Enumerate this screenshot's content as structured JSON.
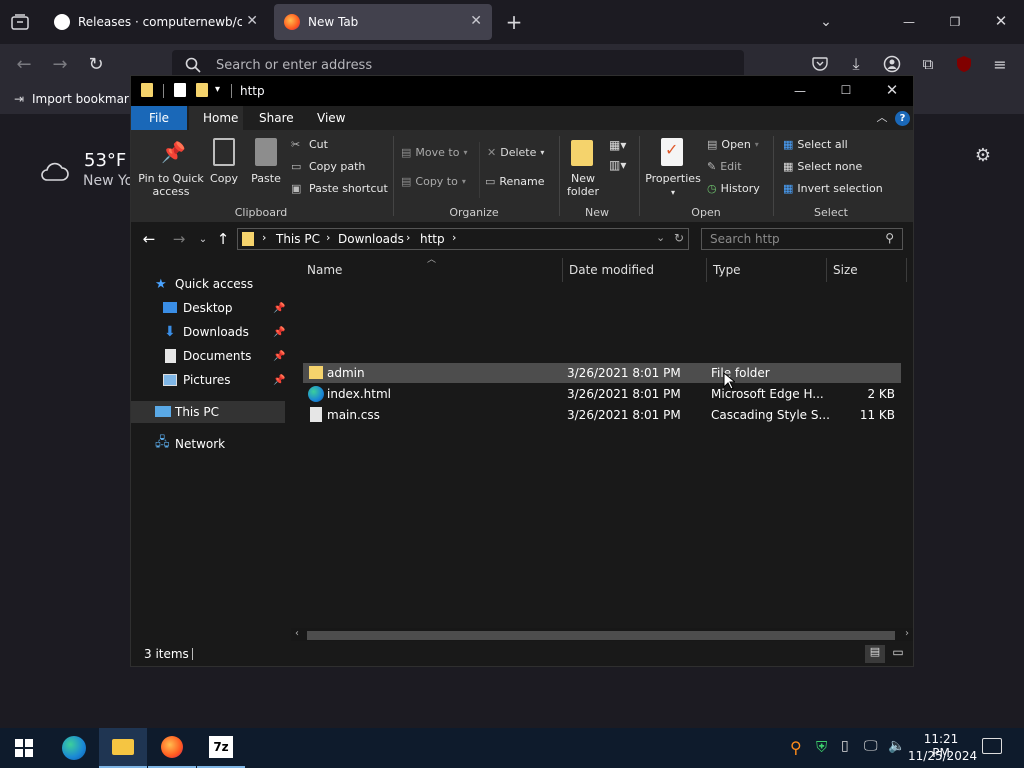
{
  "browser": {
    "tabs": [
      {
        "label": "Releases · computernewb/colla",
        "active": false
      },
      {
        "label": "New Tab",
        "active": true
      }
    ],
    "url_placeholder": "Search or enter address",
    "bookmarks_label": "Import bookmarks...",
    "weather": {
      "temp": "53°F",
      "location": "New Yo"
    }
  },
  "explorer": {
    "title": "http",
    "ribbon_tabs": [
      "File",
      "Home",
      "Share",
      "View"
    ],
    "clipboard": {
      "pin": "Pin to Quick access",
      "copy": "Copy",
      "paste": "Paste",
      "cut": "Cut",
      "copy_path": "Copy path",
      "paste_shortcut": "Paste shortcut",
      "label": "Clipboard"
    },
    "organize": {
      "move_to": "Move to",
      "copy_to": "Copy to",
      "delete": "Delete",
      "rename": "Rename",
      "label": "Organize"
    },
    "new_group": {
      "new_folder": "New folder",
      "label": "New"
    },
    "open_group": {
      "properties": "Properties",
      "open": "Open",
      "edit": "Edit",
      "history": "History",
      "label": "Open"
    },
    "select_group": {
      "select_all": "Select all",
      "select_none": "Select none",
      "invert": "Invert selection",
      "label": "Select"
    },
    "breadcrumb": [
      "This PC",
      "Downloads",
      "http"
    ],
    "search_placeholder": "Search http",
    "nav": {
      "quick_access": "Quick access",
      "desktop": "Desktop",
      "downloads": "Downloads",
      "documents": "Documents",
      "pictures": "Pictures",
      "this_pc": "This PC",
      "network": "Network"
    },
    "columns": [
      "Name",
      "Date modified",
      "Type",
      "Size"
    ],
    "files": [
      {
        "name": "admin",
        "date": "3/26/2021 8:01 PM",
        "type": "File folder",
        "size": ""
      },
      {
        "name": "index.html",
        "date": "3/26/2021 8:01 PM",
        "type": "Microsoft Edge H...",
        "size": "2 KB"
      },
      {
        "name": "main.css",
        "date": "3/26/2021 8:01 PM",
        "type": "Cascading Style S...",
        "size": "11 KB"
      }
    ],
    "status": "3 items"
  },
  "taskbar": {
    "time": "11:21 PM",
    "date": "11/25/2024",
    "app_7z": "7z"
  }
}
